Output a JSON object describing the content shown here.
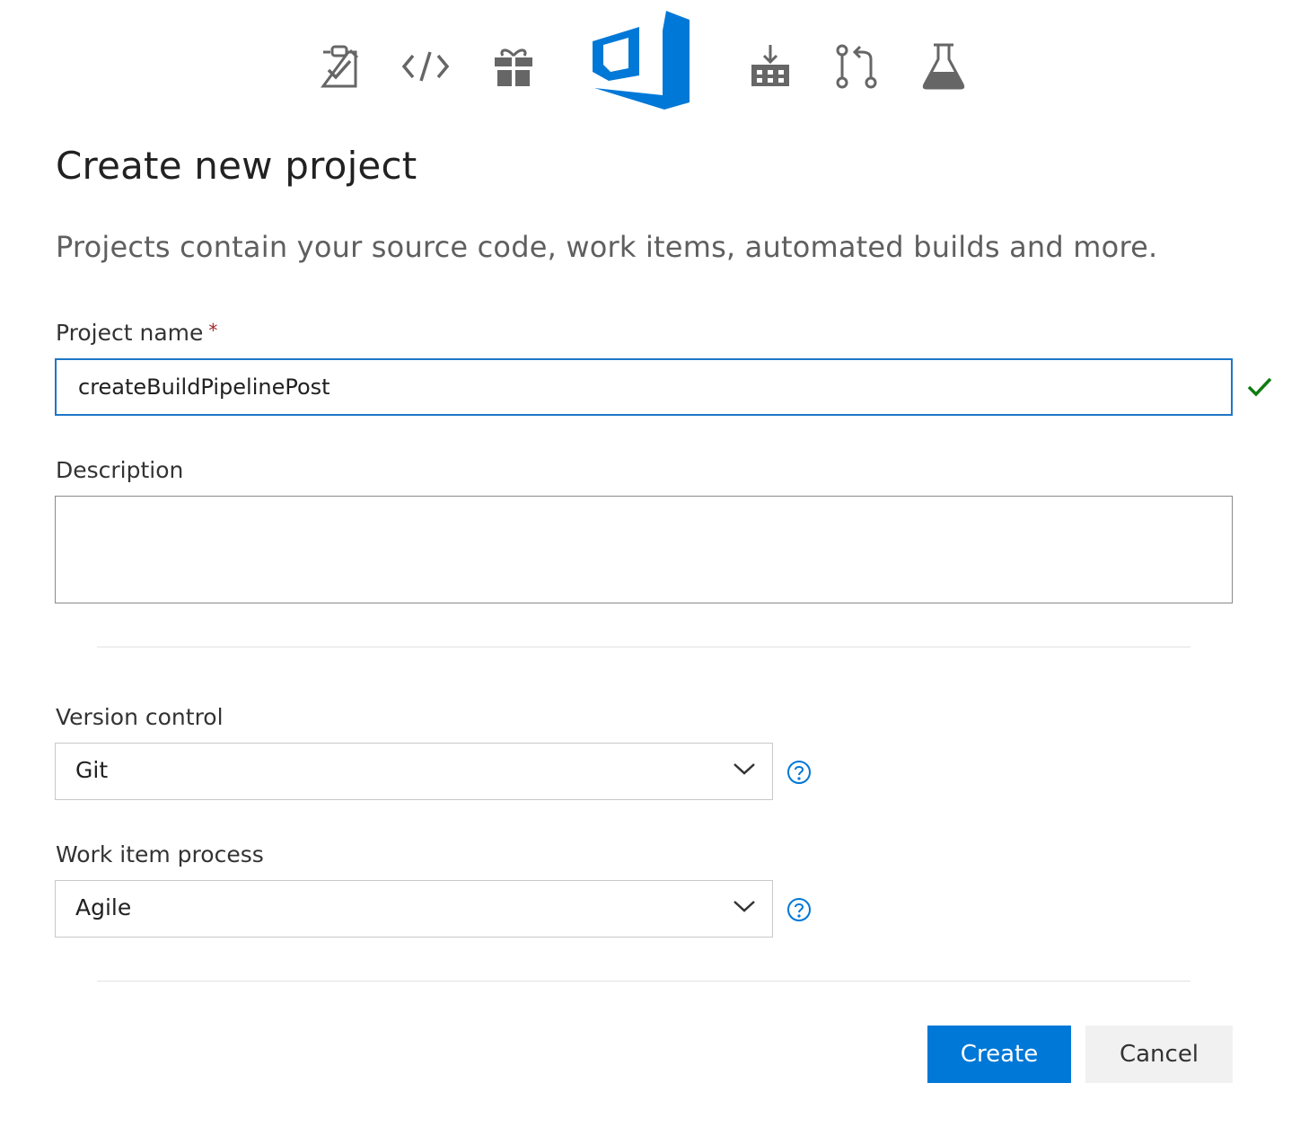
{
  "page": {
    "title": "Create new project",
    "subtitle": "Projects contain your source code, work items, automated builds and more."
  },
  "hub_icons": [
    "boards-icon",
    "code-icon",
    "artifacts-gift-icon",
    "azure-devops-logo",
    "builds-pipelines-icon",
    "pull-request-icon",
    "test-plans-icon"
  ],
  "colors": {
    "accent": "#0078d7",
    "input_focus_border": "#1e76c8",
    "valid_check": "#107c10",
    "required_star": "#a4262c",
    "icon_gray": "#666666"
  },
  "form": {
    "project_name": {
      "label": "Project name",
      "required_mark": "*",
      "value": "createBuildPipelinePost",
      "valid": true
    },
    "description": {
      "label": "Description",
      "value": ""
    },
    "version_control": {
      "label": "Version control",
      "selected": "Git"
    },
    "work_item_process": {
      "label": "Work item process",
      "selected": "Agile"
    }
  },
  "actions": {
    "create_label": "Create",
    "cancel_label": "Cancel"
  }
}
